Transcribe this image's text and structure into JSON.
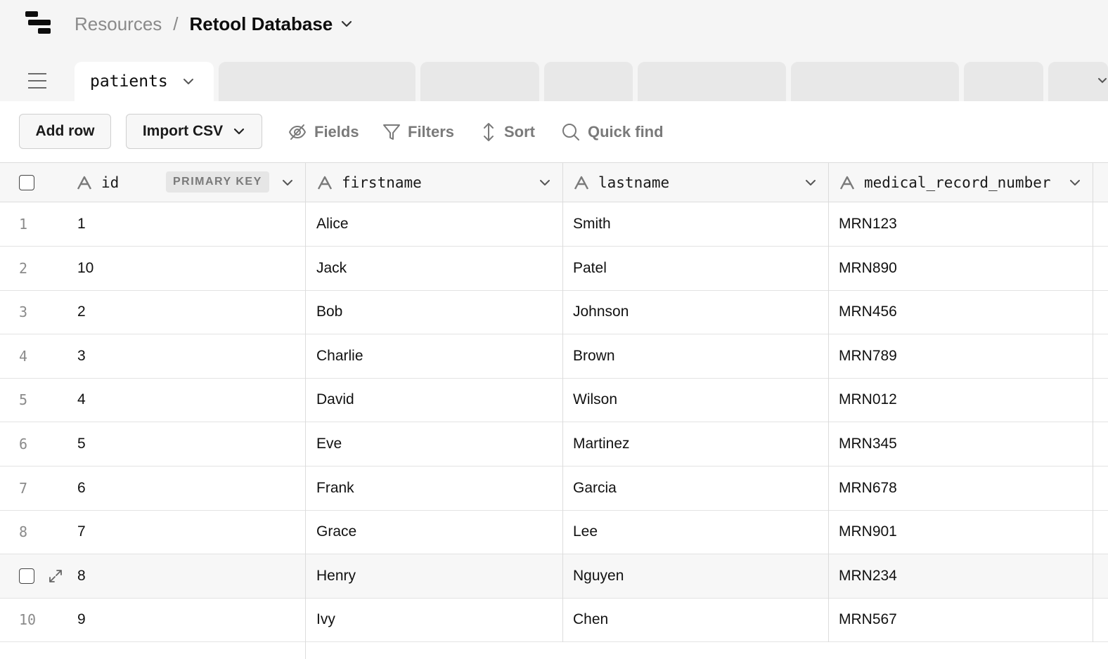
{
  "breadcrumb": {
    "parent": "Resources",
    "separator": "/",
    "current": "Retool Database"
  },
  "tabs": {
    "active_label": "patients"
  },
  "toolbar": {
    "add_row": "Add row",
    "import_csv": "Import CSV",
    "fields": "Fields",
    "filters": "Filters",
    "sort": "Sort",
    "quick_find": "Quick find"
  },
  "table": {
    "columns": [
      {
        "name": "id",
        "badge": "PRIMARY KEY"
      },
      {
        "name": "firstname"
      },
      {
        "name": "lastname"
      },
      {
        "name": "medical_record_number"
      }
    ],
    "rows": [
      {
        "num": "1",
        "id": "1",
        "firstname": "Alice",
        "lastname": "Smith",
        "mrn": "MRN123"
      },
      {
        "num": "2",
        "id": "10",
        "firstname": "Jack",
        "lastname": "Patel",
        "mrn": "MRN890"
      },
      {
        "num": "3",
        "id": "2",
        "firstname": "Bob",
        "lastname": "Johnson",
        "mrn": "MRN456"
      },
      {
        "num": "4",
        "id": "3",
        "firstname": "Charlie",
        "lastname": "Brown",
        "mrn": "MRN789"
      },
      {
        "num": "5",
        "id": "4",
        "firstname": "David",
        "lastname": "Wilson",
        "mrn": "MRN012"
      },
      {
        "num": "6",
        "id": "5",
        "firstname": "Eve",
        "lastname": "Martinez",
        "mrn": "MRN345"
      },
      {
        "num": "7",
        "id": "6",
        "firstname": "Frank",
        "lastname": "Garcia",
        "mrn": "MRN678"
      },
      {
        "num": "8",
        "id": "7",
        "firstname": "Grace",
        "lastname": "Lee",
        "mrn": "MRN901"
      },
      {
        "num": "9",
        "id": "8",
        "firstname": "Henry",
        "lastname": "Nguyen",
        "mrn": "MRN234"
      },
      {
        "num": "10",
        "id": "9",
        "firstname": "Ivy",
        "lastname": "Chen",
        "mrn": "MRN567"
      }
    ]
  },
  "icons": {
    "logo": "retool-logo-icon",
    "menu": "hamburger-menu-icon",
    "fields": "eye-off-icon",
    "filters": "filter-funnel-icon",
    "sort": "sort-arrows-icon",
    "quick_find": "search-icon",
    "column_type": "text-type-icon",
    "expand_row": "expand-icon"
  },
  "colors": {
    "muted_text": "#7a7a7a",
    "border": "#dcdcdc",
    "background": "#f5f5f5"
  }
}
